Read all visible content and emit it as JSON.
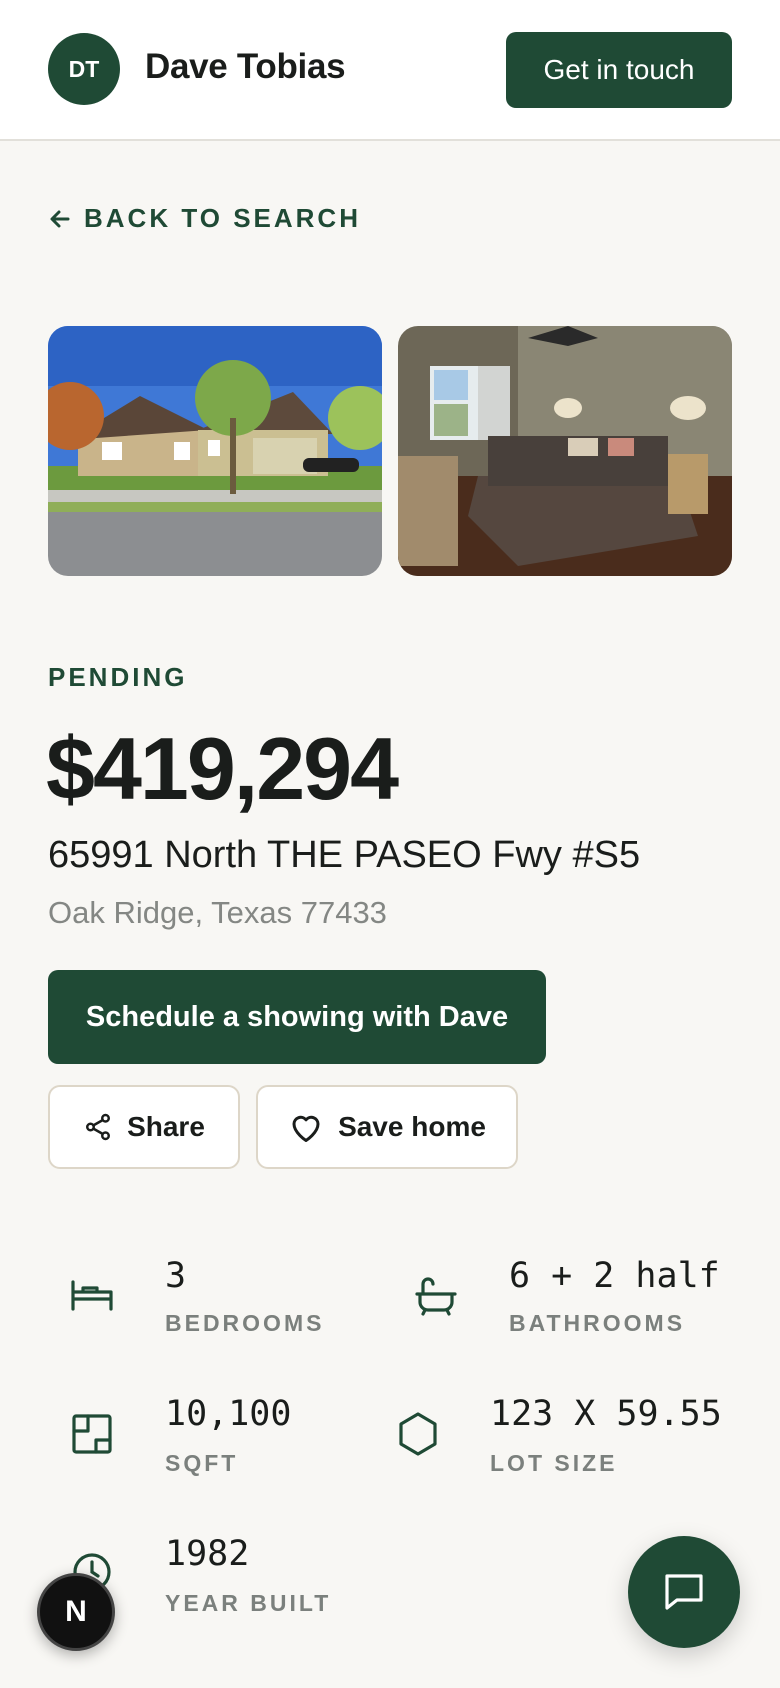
{
  "header": {
    "avatar_initials": "DT",
    "agent_name": "Dave Tobias",
    "contact_label": "Get in touch"
  },
  "nav": {
    "back_label": "BACK TO SEARCH"
  },
  "listing": {
    "status": "PENDING",
    "price": "$419,294",
    "street": "65991 North THE PASEO Fwy #S5",
    "city_line": "Oak Ridge, Texas 77433"
  },
  "actions": {
    "schedule_label": "Schedule a showing with Dave",
    "share_label": "Share",
    "save_label": "Save home"
  },
  "facts": [
    {
      "icon": "bed-icon",
      "value": "3",
      "label": "BEDROOMS"
    },
    {
      "icon": "bathtub-icon",
      "value": "6 + 2 half",
      "label": "BATHROOMS"
    },
    {
      "icon": "floorplan-icon",
      "value": "10,100",
      "label": "SQFT"
    },
    {
      "icon": "hexagon-icon",
      "value": "123 X 59.55",
      "label": "LOT SIZE"
    },
    {
      "icon": "clock-icon",
      "value": "1982",
      "label": "YEAR BUILT"
    }
  ],
  "floating": {
    "chat_icon": "chat-bubble-icon",
    "dev_badge": "N"
  },
  "colors": {
    "brand": "#1f4a35",
    "background": "#f8f7f4",
    "muted_text": "#848784"
  }
}
